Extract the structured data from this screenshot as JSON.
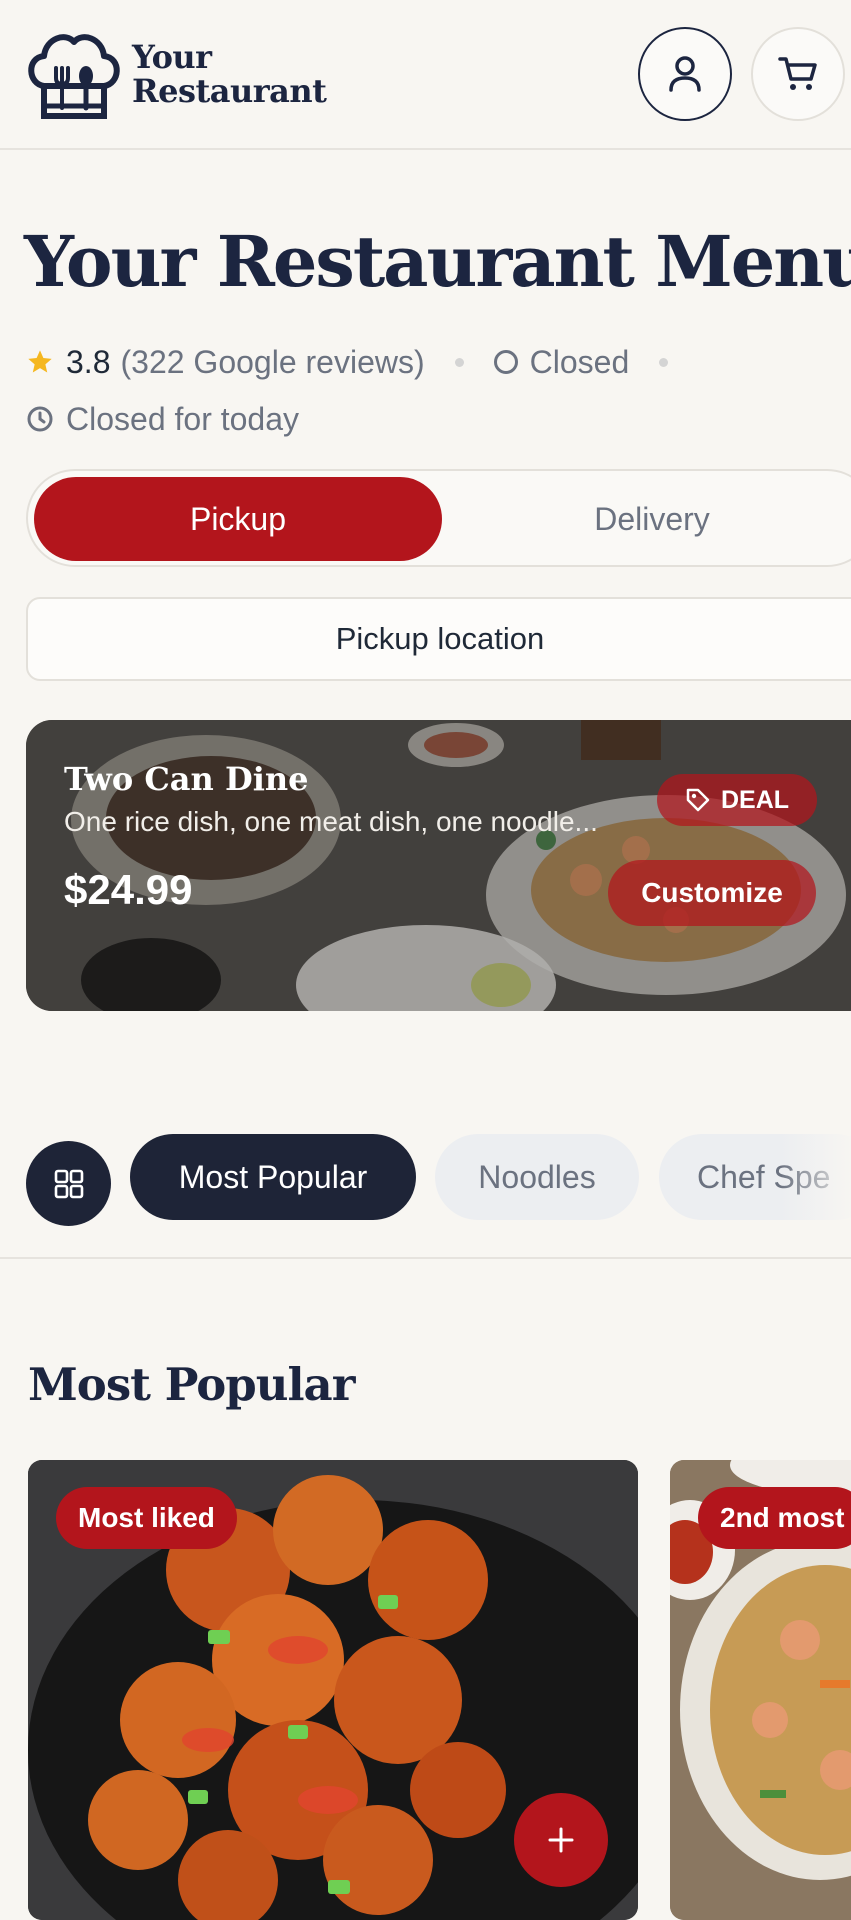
{
  "header": {
    "brand_line1": "Your",
    "brand_line2": "Restaurant",
    "logo_icon": "chef-hat-fork-spoon-icon",
    "account_icon": "user-icon",
    "cart_icon": "cart-icon"
  },
  "restaurant": {
    "title": "Your Restaurant Menu",
    "rating": "3.8",
    "reviews": "(322 Google reviews)",
    "status": "Closed",
    "hours": "Closed for today"
  },
  "order_mode": {
    "pickup_label": "Pickup",
    "delivery_label": "Delivery",
    "selected": "Pickup"
  },
  "location_button": "Pickup location",
  "deal": {
    "title": "Two Can Dine",
    "description": "One rice dish, one meat dish, one noodle...",
    "price": "$24.99",
    "badge": "DEAL",
    "action": "Customize"
  },
  "categories": {
    "items": [
      "Most Popular",
      "Noodles",
      "Chef Spe"
    ],
    "selected": "Most Popular"
  },
  "section": {
    "title": "Most Popular",
    "items": [
      {
        "badge": "Most liked",
        "image": "glazed-chicken-photo"
      },
      {
        "badge": "2nd most",
        "image": "noodles-photo"
      }
    ]
  },
  "colors": {
    "accent": "#b3151c",
    "dark": "#1e2437",
    "background": "#f8f6f2",
    "muted": "#6b7280",
    "star": "#f5b71f"
  }
}
